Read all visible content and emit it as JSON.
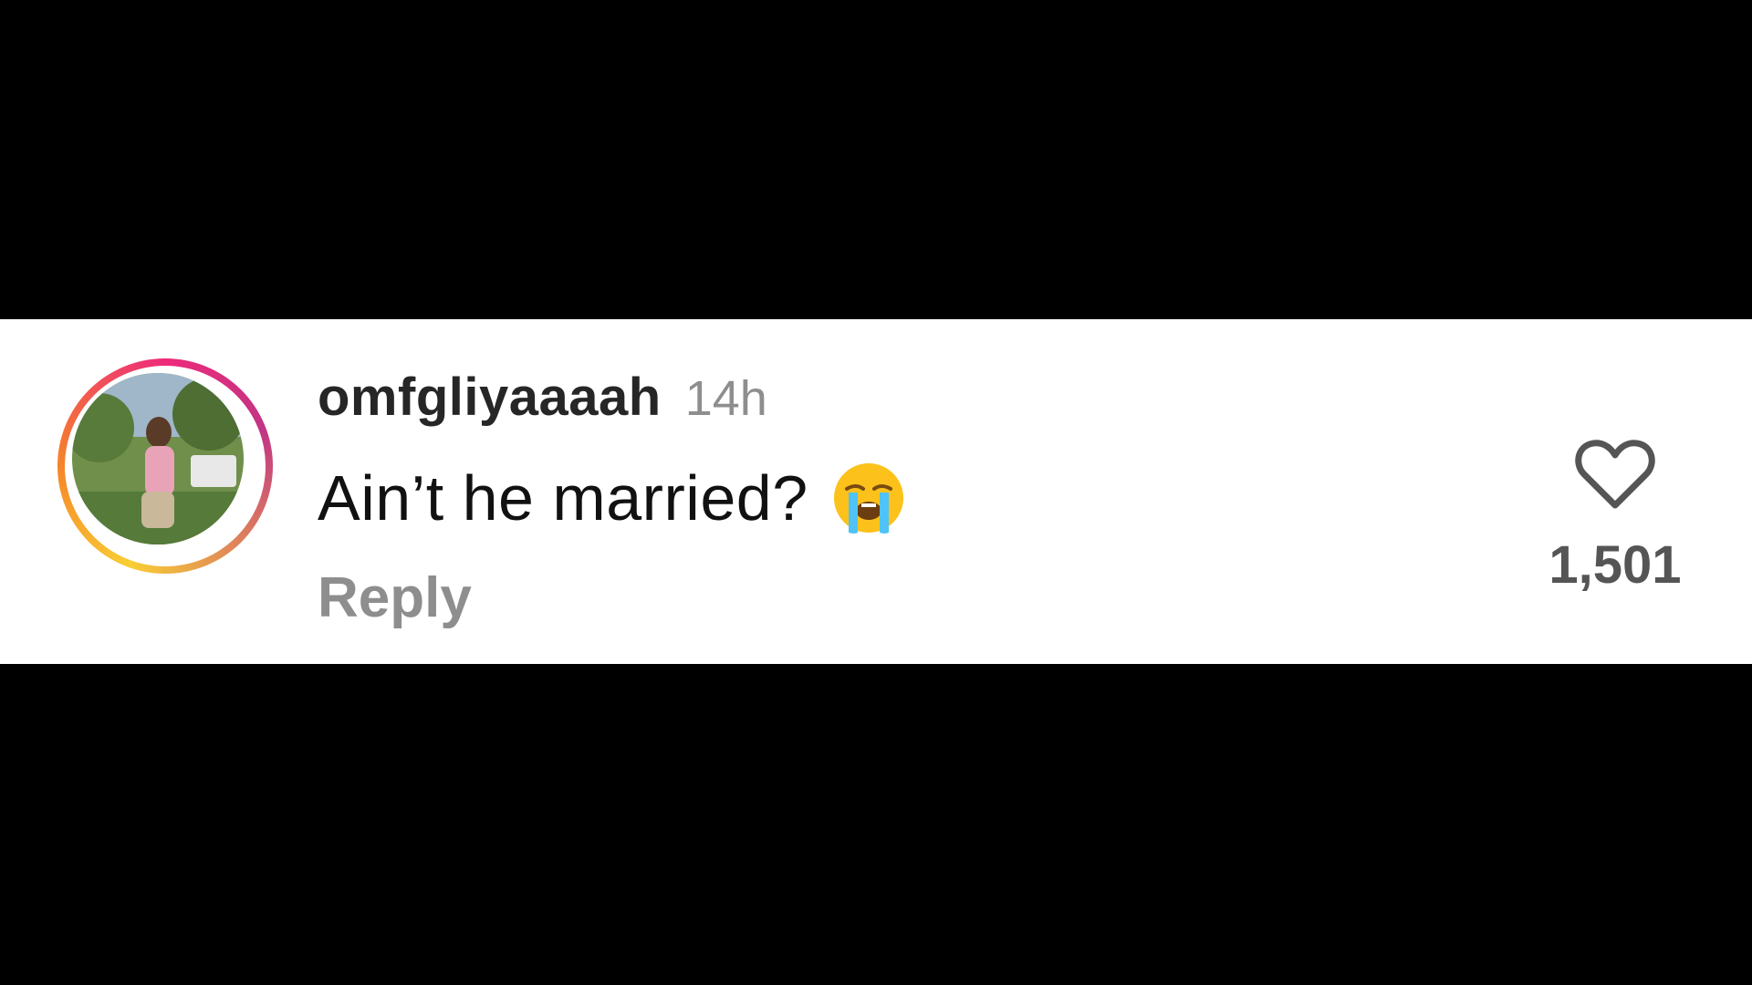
{
  "comment": {
    "username": "omfgliyaaaah",
    "time": "14h",
    "text": "Ain’t he married?",
    "emoji": "loudly-crying-face-emoji",
    "reply_label": "Reply",
    "like_count": "1,501"
  },
  "icons": {
    "like": "heart-icon",
    "avatar_ring": "story-ring"
  },
  "colors": {
    "background_band": "#000000",
    "card": "#ffffff",
    "username": "#262626",
    "muted": "#8e8e8e",
    "ring_start": "#f9ce34",
    "ring_mid": "#ee2a7b",
    "ring_end": "#c13584"
  }
}
